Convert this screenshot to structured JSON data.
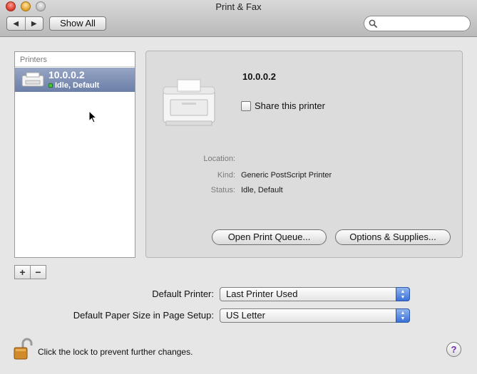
{
  "window": {
    "title": "Print & Fax"
  },
  "toolbar": {
    "back_glyph": "◀",
    "forward_glyph": "▶",
    "show_all_label": "Show All",
    "search_placeholder": ""
  },
  "printers": {
    "header": "Printers",
    "items": [
      {
        "name": "10.0.0.2",
        "status": "Idle, Default",
        "status_color": "#3fc63a",
        "selected": true
      }
    ],
    "add_label": "+",
    "remove_label": "−"
  },
  "detail": {
    "name": "10.0.0.2",
    "share_label": "Share this printer",
    "share_checked": false,
    "location_label": "Location:",
    "location_value": "",
    "kind_label": "Kind:",
    "kind_value": "Generic PostScript Printer",
    "status_label": "Status:",
    "status_value": "Idle, Default",
    "open_queue_label": "Open Print Queue...",
    "options_label": "Options & Supplies..."
  },
  "defaults": {
    "default_printer_label": "Default Printer:",
    "default_printer_value": "Last Printer Used",
    "paper_size_label": "Default Paper Size in Page Setup:",
    "paper_size_value": "US Letter"
  },
  "footer": {
    "lock_text": "Click the lock to prevent further changes.",
    "help_label": "?"
  },
  "colors": {
    "selection": "#7b8db3",
    "popup_accent": "#3a71d8",
    "lock": "#d08a2a"
  }
}
